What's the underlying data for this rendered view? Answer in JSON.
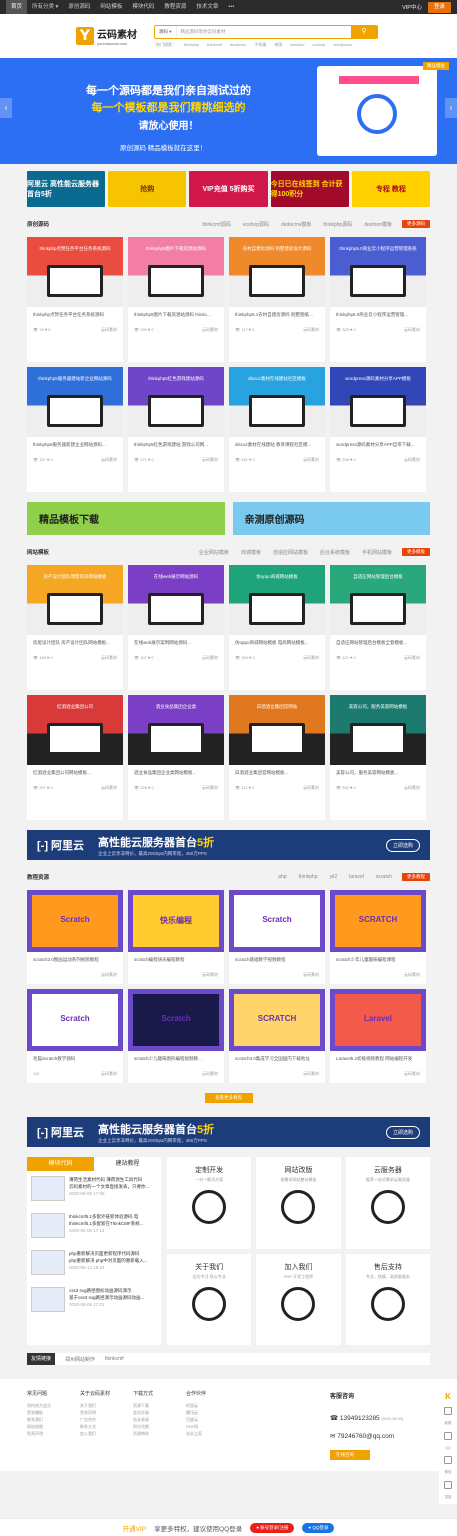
{
  "topbar": {
    "nav": [
      "首页",
      "所有分类 ▾",
      "原创源码",
      "网站模板",
      "模块代码",
      "教程资源",
      "技术文章",
      "•••"
    ],
    "vip": "VIP中心",
    "login": "登录"
  },
  "header": {
    "logo_text": "云码素材",
    "logo_sub": "yunmasucai.com",
    "search_select": "源码 ▾",
    "search_placeholder": "精品源码等你云码素材",
    "search_btn": "⚲",
    "hotwords": [
      "热门搜索：",
      "thinkphp",
      "thinkcmf",
      "dedecms",
      "手机端",
      "帝国",
      "destoon",
      "ecshop",
      "wordpress"
    ]
  },
  "banner": {
    "line1": "每一个源码都是我们亲自测试过的",
    "line2": "每一个模板都是我们精挑细选的",
    "line3": "请放心使用！",
    "line4": "原创源码 精品模板就在这里！",
    "tag": "精品模板"
  },
  "ads": [
    "阿里云 高性能云服务器首台5折",
    "抢购",
    "VIP充值 5折购买",
    "今日已在线签到 合计获得100积分",
    "专程 教程"
  ],
  "section1": {
    "title": "原创源码",
    "tabs": [
      "thinkcmf源码",
      "ecshop源码",
      "dedecms模板",
      "thinkphp源码",
      "destoon模板"
    ],
    "more": "更多源码",
    "cards": [
      {
        "title": "thinkphp点赞任务平台任务系统源码",
        "cap": "thinkphp点赞任务平台任务系统源码",
        "views": "74",
        "likes": "0",
        "author": "云码素材",
        "color": "#e94d3f"
      },
      {
        "title": "thinkphp5图片下载资源站源码",
        "cap": "thinkphp5图片下载资源站源码 thinkc...",
        "views": "130",
        "likes": "0",
        "author": "云码素材",
        "color": "#f27ea5"
      },
      {
        "title": "农村自建房源码 别墅建房设计源码",
        "cap": "thinkphp5.1农村自建房源码 别墅图纸...",
        "views": "117",
        "likes": "0",
        "author": "云码素材",
        "color": "#f0892b"
      },
      {
        "title": "thinkphp5.0商业云小程序运营管理系统",
        "cap": "thinkphp5.0商业云小程序运营管理...",
        "views": "325",
        "likes": "0",
        "author": "云码素材",
        "color": "#4a5dd1"
      },
      {
        "title": "thinkphp5服务器建站新企业网站源码",
        "cap": "thinkphp5服务器新建企业网站源码...",
        "views": "157",
        "likes": "0",
        "author": "云码素材",
        "color": "#2f6fd8"
      },
      {
        "title": "thinkphp5红色游戏建站源码",
        "cap": "thinkphp5红色游戏建站 游戏公司网...",
        "views": "171",
        "likes": "0",
        "author": "云码素材",
        "color": "#7046c9"
      },
      {
        "title": "discuz素材在线建站社区模板",
        "cap": "discuz素材在线建站 教育课程社区模...",
        "views": "241",
        "likes": "0",
        "author": "云码素材",
        "color": "#27a4e0"
      },
      {
        "title": "wordpress源码素材分享APP模板",
        "cap": "wordpress源码素材分享APP自带下载...",
        "views": "298",
        "likes": "0",
        "author": "云码素材",
        "color": "#3147b8"
      }
    ]
  },
  "banners2": [
    "精品模板下载",
    "亲测原创源码"
  ],
  "banners2_sub": "yunmasucai.com",
  "section2": {
    "title": "网站模板",
    "tabs": [
      "企业网站模板",
      "商城模板",
      "自适应网站模板",
      "后台系统模板",
      "手机网站模板"
    ],
    "more": "更多模板",
    "cards": [
      {
        "title": "房产设计团队博客资讯网站模板",
        "cap": "房屋设计团队 房产设计团队网站模板...",
        "views": "148",
        "likes": "0",
        "author": "云码素材",
        "color": "#f5a623"
      },
      {
        "title": "在线web展示网站源码",
        "cap": "在线web展示案例网站源码...",
        "views": "107",
        "likes": "0",
        "author": "云码素材",
        "color": "#7b3fc6"
      },
      {
        "title": "仿oppo商城网站模板",
        "cap": "仿oppo商城网站模板 电商网站模板...",
        "views": "150",
        "likes": "0",
        "author": "云码素材",
        "color": "#1fa37a"
      },
      {
        "title": "自适应网站管理后台模板",
        "cap": "自适应网站管理后台模板全套模板...",
        "views": "121",
        "likes": "0",
        "author": "云码素材",
        "color": "#29a87c"
      },
      {
        "title": "红酒酒业集团公司",
        "cap": "红酒酒业集团公司网站模板...",
        "views": "207",
        "likes": "0",
        "author": "云码素材",
        "color": "#d83a3a"
      },
      {
        "title": "酒业食品集团企业类",
        "cap": "酒业食品集团企业类网站模板...",
        "views": "226",
        "likes": "0",
        "author": "云码素材",
        "color": "#7b3fc6"
      },
      {
        "title": "白酒酒业集团官网站",
        "cap": "白酒酒业集团官网站模板...",
        "views": "112",
        "likes": "0",
        "author": "云码素材",
        "color": "#e0781f"
      },
      {
        "title": "美容公司，服务美容网站模板",
        "cap": "美容公司，服务美容网站模板...",
        "views": "332",
        "likes": "0",
        "author": "云码素材",
        "color": "#1c7a6f"
      }
    ]
  },
  "cloudbar": {
    "brand": "[-] 阿里云",
    "slogan": "高性能云服务器首台",
    "highlight": "5折",
    "sub": "企业上云享非特价，最高20Gbps内网带宽，450万PPS",
    "buy": "立即选购"
  },
  "section3": {
    "title": "教程资源",
    "tabs": [
      "php",
      "thinkphp",
      "yii2",
      "laravel",
      "scratch"
    ],
    "more": "更多教程",
    "cards": [
      {
        "cap": "scratch2.0图画运动系列视频教程",
        "views": "",
        "author": "云码素材",
        "word": "Scratch"
      },
      {
        "cap": "scratch编程快乐编程教程",
        "views": "",
        "author": "云码素材",
        "word": "快乐编程"
      },
      {
        "cap": "scratch基础教学视频教程",
        "views": "",
        "author": "云码素材",
        "word": "Scratch"
      },
      {
        "cap": "scratch少年儿童趣味编程课程",
        "views": "",
        "author": "云码素材",
        "word": "SCRATCH"
      },
      {
        "cap": "毛猫Scratch教学源码",
        "views": "114",
        "author": "云码素材",
        "word": "Scratch"
      },
      {
        "cap": "scratch少儿趣味图形编程视频教...",
        "views": "",
        "author": "云码素材",
        "word": "Scratch"
      },
      {
        "cap": "scratch3.0集成学习全国国内下载地址",
        "views": "",
        "author": "云码素材",
        "word": "SCRATCH"
      },
      {
        "cap": "Laravel5.2初级视频教程 网站编程开发",
        "views": "",
        "author": "云码素材",
        "word": "Laravel"
      }
    ],
    "more_btn": "查看更多教程"
  },
  "bottom": {
    "tabs": [
      "模块代码",
      "建站教程"
    ],
    "items": [
      {
        "t": "薄荷生活素材代码 薄荷源生工具代码",
        "s": "云码素材的一个文章直接发表，只要你...",
        "d": "2020-06-06 17:06"
      },
      {
        "t": "thinkcmf5.1多套外链新体验源码 电",
        "s": "thinkcmf5.1多套新在ThinkCMF系统...",
        "d": "2020-06-06 17:14"
      },
      {
        "t": "php重新解决页面更新程序代码源码",
        "s": "php重新解决 php中对页面的重新载入...",
        "d": "2020-06-12 18:24"
      },
      {
        "t": "css3 svg路径图标动画源码演示",
        "s": "基于css3 svg路径演示动画源码动画...",
        "d": "2020-06-06 17:21"
      }
    ],
    "services": [
      {
        "h": "定制开发",
        "s": "一对一解决方案"
      },
      {
        "h": "网站改版",
        "s": "按需求网站整站模板"
      },
      {
        "h": "云服务器",
        "s": "推荐一站式需求云服务器"
      },
      {
        "h": "关于我们",
        "s": "因为专注 所以专业"
      },
      {
        "h": "加入我们",
        "s": "PHP 开发工程师"
      },
      {
        "h": "售后支持",
        "s": "专业、热情、高质量服务"
      }
    ]
  },
  "links": {
    "label": "友情链接",
    "items": [
      "郑州网站制作",
      "thinkcmf"
    ]
  },
  "footer": {
    "cols": [
      {
        "h": "常见问题",
        "items": [
          "如何成为会员",
          "签到赚取",
          "联系我们",
          "网站地图",
          "免责声明"
        ]
      },
      {
        "h": "关于云码素材",
        "items": [
          "关于我们",
          "免责声明",
          "广告合作",
          "联系方式",
          "加入我们"
        ]
      },
      {
        "h": "下载方式",
        "items": [
          "资源下载",
          "会员升级",
          "站长收录",
          "积分兑换",
          "资源审核"
        ]
      },
      {
        "h": "合作伙伴",
        "items": [
          "阿里云",
          "腾讯云",
          "百度云",
          "PHP网",
          "站长之家"
        ]
      }
    ],
    "contact_title": "客服咨询",
    "phone": "13949123285",
    "phone_hours": "(9:00-18:00)",
    "email": "79246760@qq.com",
    "qq_btn": "在线咨询"
  },
  "sidebar": {
    "k": "K",
    "items": [
      "客服",
      "QQ",
      "微信",
      "顶部"
    ]
  },
  "vipbar": {
    "vip": "开通VIP",
    "text": "享更多特权，建议使用QQ登录",
    "b1": "● 账号登录/注册",
    "b2": "● QQ登录"
  }
}
